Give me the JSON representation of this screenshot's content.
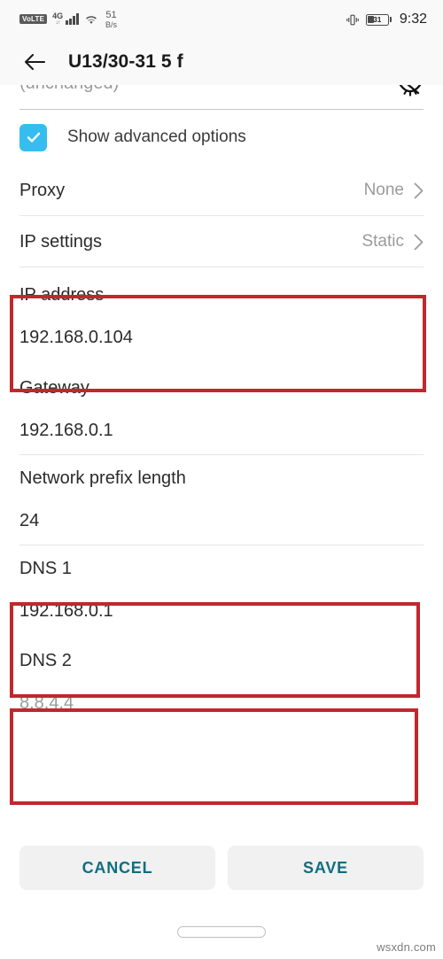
{
  "status_bar": {
    "volte_badge": "VoLTE",
    "network_gen": "4G",
    "network_sub": "↓↑",
    "signal_icon": "signal-bars-icon",
    "wifi_icon": "wifi-icon",
    "data_rate_value": "51",
    "data_rate_unit": "B/s",
    "vibrate_icon": "vibrate-icon",
    "battery_percent": "31",
    "clock": "9:32"
  },
  "app_bar": {
    "back_icon": "back-arrow-icon",
    "title": "U13/30-31 5 f"
  },
  "form": {
    "clipped_password_text": "(unchanged)",
    "password_toggle_icon": "eye-off-icon",
    "advanced_options": {
      "label": "Show advanced options",
      "checked": true,
      "check_icon": "checkmark-icon",
      "color": "#36bdef"
    },
    "rows": [
      {
        "label": "Proxy",
        "value": "None",
        "chevron_icon": "chevron-right-icon",
        "type": "select"
      },
      {
        "label": "IP settings",
        "value": "Static",
        "chevron_icon": "chevron-right-icon",
        "type": "select"
      }
    ],
    "fields": [
      {
        "label": "IP address",
        "value": "192.168.0.104",
        "is_placeholder": false,
        "highlighted": true
      },
      {
        "label": "Gateway",
        "value": "192.168.0.1",
        "is_placeholder": false,
        "highlighted": false
      },
      {
        "label": "Network prefix length",
        "value": "24",
        "is_placeholder": false,
        "highlighted": false
      },
      {
        "label": "DNS 1",
        "value": "192.168.0.1",
        "is_placeholder": false,
        "highlighted": true
      },
      {
        "label": "DNS 2",
        "value": "8.8.4.4",
        "is_placeholder": true,
        "highlighted": true
      }
    ]
  },
  "actions": {
    "cancel_label": "CANCEL",
    "save_label": "SAVE",
    "accent_color": "#0f6e80"
  },
  "nav_bar": {
    "home_pill": "home-gesture-pill"
  },
  "annotations": {
    "highlight_color": "#c2272d",
    "boxes": [
      "IP address",
      "DNS 1",
      "DNS 2"
    ]
  },
  "watermark": "wsxdn.com"
}
